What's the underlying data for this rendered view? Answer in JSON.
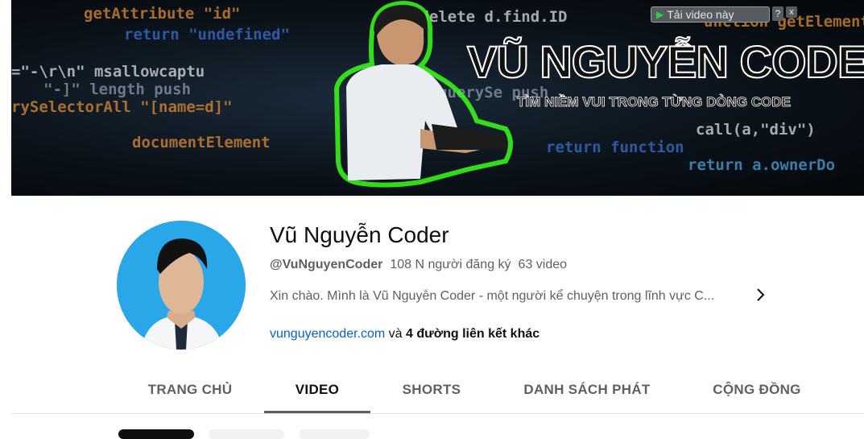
{
  "banner": {
    "brand": "VŨ NGUYỄN CODER",
    "slogan": "TÌM NIỀM VUI TRONG TỪNG DÒNG CODE",
    "download_button": "Tải video này",
    "help": "?",
    "close": "x",
    "code_lines": [
      {
        "text": "getAttribute \"id\"",
        "cls": "c-orange"
      },
      {
        "text": "return \"undefined\"",
        "cls": "c-blue"
      },
      {
        "text": "=\"-\\r\\n\"  msallowcaptu",
        "cls": "c-white"
      },
      {
        "text": "\"-]\"  length   push",
        "cls": "c-grey"
      },
      {
        "text": "rySelectorAll \"[name=d]\"",
        "cls": "c-orange"
      },
      {
        "text": "documentElement",
        "cls": "c-orange"
      },
      {
        "text": ".delete  d.find.ID",
        "cls": "c-white"
      },
      {
        "text": "querySe   push",
        "cls": "c-grey"
      },
      {
        "text": "return   function",
        "cls": "c-blue"
      },
      {
        "text": "call(a,\"div\")",
        "cls": "c-white"
      },
      {
        "text": "return a.ownerDo",
        "cls": "c-lblue"
      },
      {
        "text": "unction  getElement",
        "cls": "c-orange"
      }
    ]
  },
  "channel": {
    "name": "Vũ Nguyễn Coder",
    "handle": "@VuNguyenCoder",
    "subscribers": "108 N người đăng ký",
    "videos": "63 video",
    "description": "Xin chào. Mình là Vũ Nguyễn Coder - một người kể chuyện trong lĩnh vực C...",
    "link": "vunguyencoder.com",
    "link_connector": "và",
    "more_links": "4 đường liên kết khác",
    "more_icon": "chevron-right-icon"
  },
  "tabs": [
    {
      "label": "TRANG CHỦ",
      "active": false
    },
    {
      "label": "VIDEO",
      "active": true
    },
    {
      "label": "SHORTS",
      "active": false
    },
    {
      "label": "DANH SÁCH PHÁT",
      "active": false
    },
    {
      "label": "CỘNG ĐỒNG",
      "active": false
    }
  ],
  "colors": {
    "link": "#065fd4",
    "avatar_bg": "#2aa7e8",
    "glow": "#38ff1a"
  }
}
